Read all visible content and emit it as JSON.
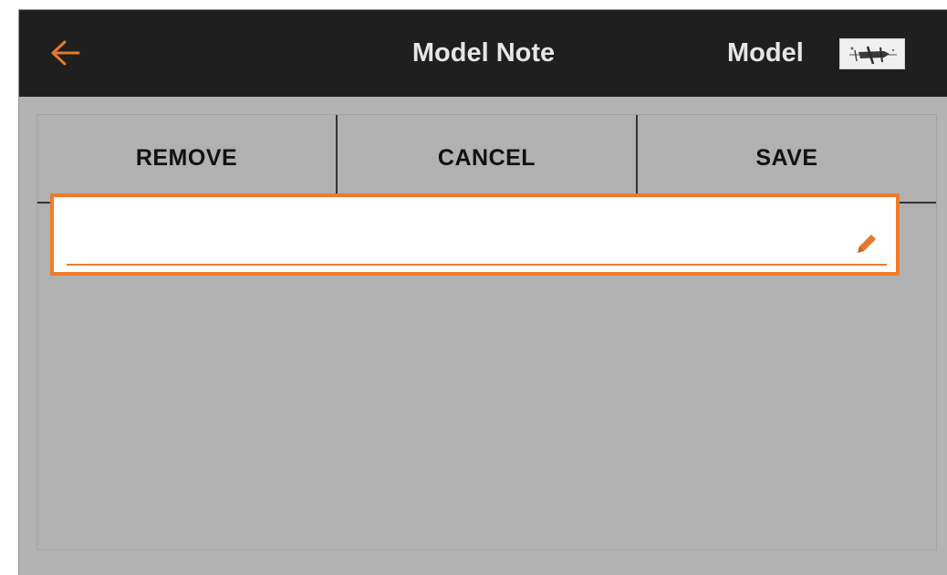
{
  "header": {
    "back_icon": "arrow-left-icon",
    "title": "Model Note",
    "model_label": "Model",
    "model_thumbnail_icon": "airplane-thumbnail-icon"
  },
  "toolbar": {
    "remove_label": "REMOVE",
    "cancel_label": "CANCEL",
    "save_label": "SAVE"
  },
  "note": {
    "value": "",
    "edit_icon": "pencil-icon"
  },
  "colors": {
    "accent": "#ef7b2b",
    "header_bg": "#1f1f1f",
    "header_text": "#e6e6e6",
    "panel_bg": "#b1b1b1"
  }
}
